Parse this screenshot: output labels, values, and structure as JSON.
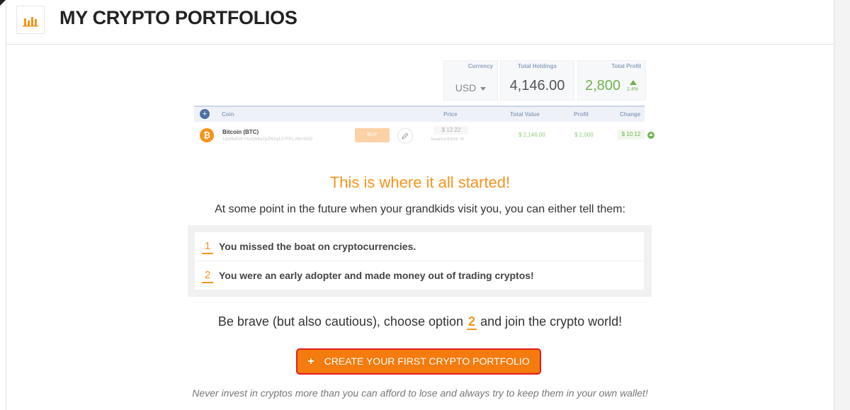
{
  "header": {
    "title": "MY CRYPTO PORTFOLIOS",
    "logo_icon": "bar-chart-icon"
  },
  "summary": {
    "currency_label": "Currency",
    "currency_value": "USD",
    "holdings_label": "Total Holdings",
    "holdings_value": "4,146.00",
    "profit_label": "Total Profit",
    "profit_value": "2,800",
    "profit_change": "2.4%"
  },
  "table": {
    "columns": [
      "Coin",
      "Price",
      "Total Value",
      "Profit",
      "Change"
    ],
    "rows": [
      {
        "coin_name": "Bitcoin (BTC)",
        "coin_address": "1Od9eEtKYXxQh6a7pZN2q12?FPL.IWzSKO",
        "buy_label": "BUY",
        "price": "$ 12.22",
        "price_sub": "bought at $ 0000, 99",
        "total_value": "$ 2,146.00",
        "profit": "$ 2,000",
        "change": "$ 10.12"
      }
    ]
  },
  "headline": "This is where it all started!",
  "intro": "At some point in the future when your grandkids visit you, you can either tell them:",
  "options": [
    {
      "num": "1",
      "text": "You missed the boat on cryptocurrencies."
    },
    {
      "num": "2",
      "text": "You were an early adopter and made money out of trading cryptos!"
    }
  ],
  "brave": {
    "before": "Be brave (but also cautious), choose option",
    "num": "2",
    "after": "and join the crypto world!"
  },
  "cta": {
    "plus": "+",
    "label": "CREATE YOUR FIRST CRYPTO PORTFOLIO"
  },
  "disclaimer": "Never invest in cryptos more than you can afford to lose and always try to keep them in your own wallet!",
  "colors": {
    "accent": "#f7941d",
    "cta": "#f47b0d",
    "cta_border": "#e31e1e",
    "positive": "#6fb34a"
  }
}
